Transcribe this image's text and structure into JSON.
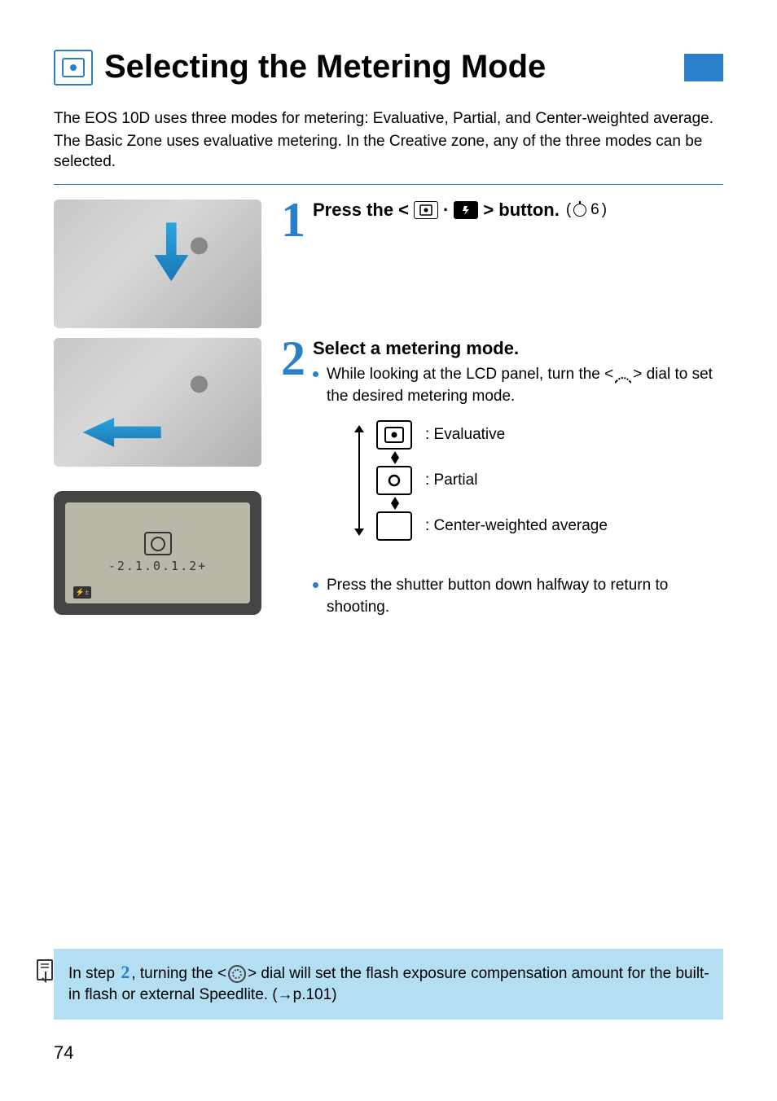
{
  "title": "Selecting the Metering Mode",
  "intro": {
    "p1": "The EOS 10D uses three modes for metering: Evaluative, Partial, and Center-weighted average.",
    "p2": "The Basic Zone uses evaluative metering. In the Creative zone, any of the three modes can be selected."
  },
  "step1": {
    "num": "1",
    "title_prefix": "Press the <",
    "title_suffix": "> button.",
    "timer_note": "6"
  },
  "step2": {
    "num": "2",
    "title": "Select a metering mode.",
    "bullet1_a": "While looking at the LCD panel, turn the <",
    "bullet1_b": "> dial to set the desired metering mode.",
    "modes": {
      "evaluative": ": Evaluative",
      "partial": ": Partial",
      "center": ": Center-weighted average"
    },
    "bullet2": "Press the shutter button down halfway to return to shooting."
  },
  "lcd": {
    "scale": "-2.1.0.1.2+"
  },
  "note": {
    "pre": "In step ",
    "step_ref": "2",
    "mid_a": ", turning the <",
    "mid_b": "> dial will set the flash exposure compensation amount for the built-in flash or external Speedlite. (",
    "arrow": "→",
    "page_ref": "p.101",
    "close": ")"
  },
  "page_number": "74"
}
